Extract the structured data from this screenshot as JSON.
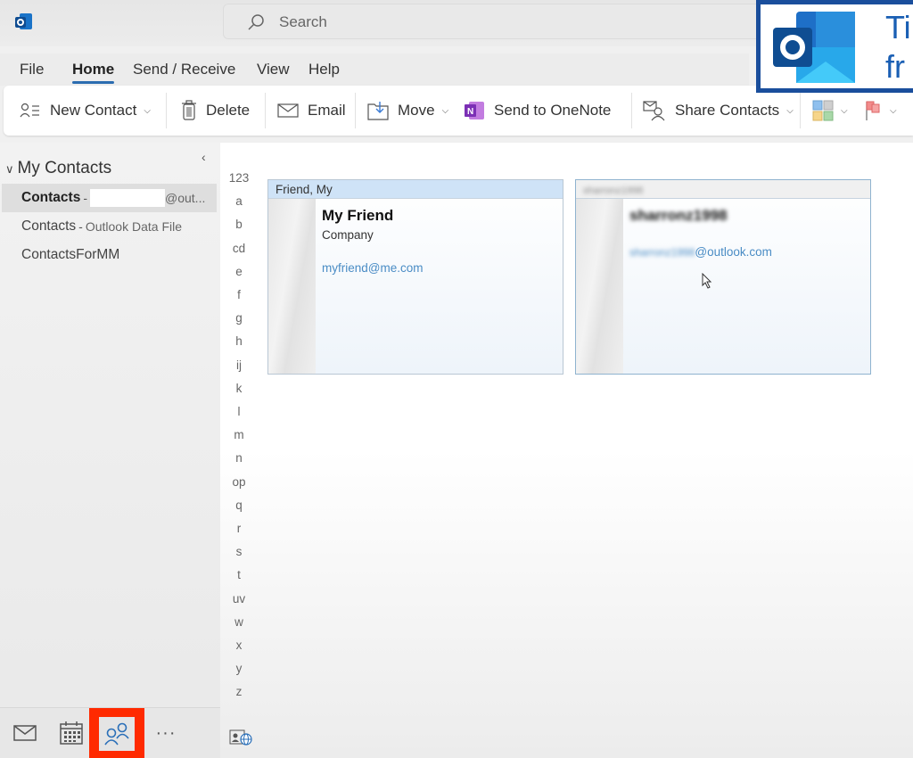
{
  "search": {
    "placeholder": "Search"
  },
  "menu": {
    "tabs": [
      {
        "label": "File",
        "active": false
      },
      {
        "label": "Home",
        "active": true
      },
      {
        "label": "Send / Receive",
        "active": false
      },
      {
        "label": "View",
        "active": false
      },
      {
        "label": "Help",
        "active": false
      }
    ]
  },
  "ribbon": {
    "new_contact": "New Contact",
    "delete": "Delete",
    "email": "Email",
    "move": "Move",
    "send_to_onenote": "Send to OneNote",
    "share_contacts": "Share Contacts"
  },
  "overlay": {
    "line1": "Ti",
    "line2": "fr"
  },
  "sidebar": {
    "group_label": "My Contacts",
    "folders": [
      {
        "name": "Contacts",
        "separator": "-",
        "sub": "@out...",
        "selected": true
      },
      {
        "name": "Contacts",
        "separator": "-",
        "sub": "Outlook Data File",
        "selected": false
      },
      {
        "name": "ContactsForMM",
        "separator": "",
        "sub": "",
        "selected": false
      }
    ]
  },
  "index": [
    "123",
    "a",
    "b",
    "cd",
    "e",
    "f",
    "g",
    "h",
    "ij",
    "k",
    "l",
    "m",
    "n",
    "op",
    "q",
    "r",
    "s",
    "t",
    "uv",
    "w",
    "x",
    "y",
    "z"
  ],
  "contacts": [
    {
      "file_as": "Friend, My",
      "name": "My Friend",
      "company": "Company",
      "email": "myfriend@me.com",
      "blurred": false
    },
    {
      "file_as": "sharronz1998",
      "name": "sharronz1998",
      "company": "",
      "email_user": "sharronz1998",
      "email_domain": "@outlook.com",
      "blurred": true
    }
  ],
  "nav": {
    "items": [
      {
        "id": "mail",
        "icon": "mail-icon"
      },
      {
        "id": "calendar",
        "icon": "calendar-icon"
      },
      {
        "id": "people",
        "icon": "people-icon",
        "active": true
      },
      {
        "id": "more",
        "icon": "more-icon",
        "label": "···"
      }
    ]
  },
  "colors": {
    "accent": "#2b6cb0",
    "highlight_border": "#ff2a00",
    "email_link": "#4a8cc5"
  }
}
